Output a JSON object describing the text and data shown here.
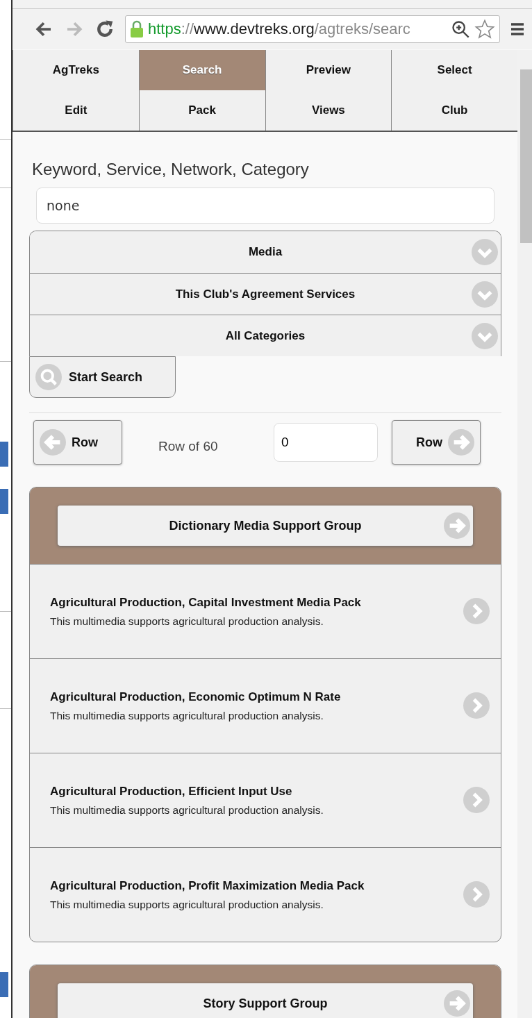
{
  "browser": {
    "back_disabled": false,
    "forward_disabled": true,
    "url_parts": [
      {
        "kind": "scheme",
        "text": "https"
      },
      {
        "kind": "path",
        "text": "://"
      },
      {
        "kind": "host",
        "text": "www.devtreks.org"
      },
      {
        "kind": "path",
        "text": "/agtreks/searc"
      }
    ]
  },
  "tabs": [
    {
      "label": "AgTreks",
      "selected": false
    },
    {
      "label": "Search",
      "selected": true
    },
    {
      "label": "Preview",
      "selected": false
    },
    {
      "label": "Select",
      "selected": false
    },
    {
      "label": "Edit",
      "selected": false
    },
    {
      "label": "Pack",
      "selected": false
    },
    {
      "label": "Views",
      "selected": false
    },
    {
      "label": "Club",
      "selected": false
    }
  ],
  "search": {
    "label": "Keyword, Service, Network, Category",
    "value": "none"
  },
  "filters": [
    {
      "label": "Media",
      "expanded": false
    },
    {
      "label": "This Club's Agreement Services",
      "expanded": false
    },
    {
      "label": "All Categories",
      "expanded": false
    }
  ],
  "start_button": "Start Search",
  "pager": {
    "prev": "Row",
    "status": "Row of 60",
    "value": "0",
    "next": "Row"
  },
  "groups": [
    {
      "title": "Dictionary Media Support Group",
      "items": [
        {
          "title": "Agricultural Production, Capital Investment Media Pack",
          "description": "This multimedia supports agricultural production analysis."
        },
        {
          "title": "Agricultural Production, Economic Optimum N Rate",
          "description": "This multimedia supports agricultural production analysis."
        },
        {
          "title": "Agricultural Production, Efficient Input Use",
          "description": "This multimedia supports agricultural production analysis."
        },
        {
          "title": "Agricultural Production, Profit Maximization Media Pack",
          "description": "This multimedia supports agricultural production analysis."
        }
      ]
    },
    {
      "title": "Story Support Group"
    }
  ]
}
